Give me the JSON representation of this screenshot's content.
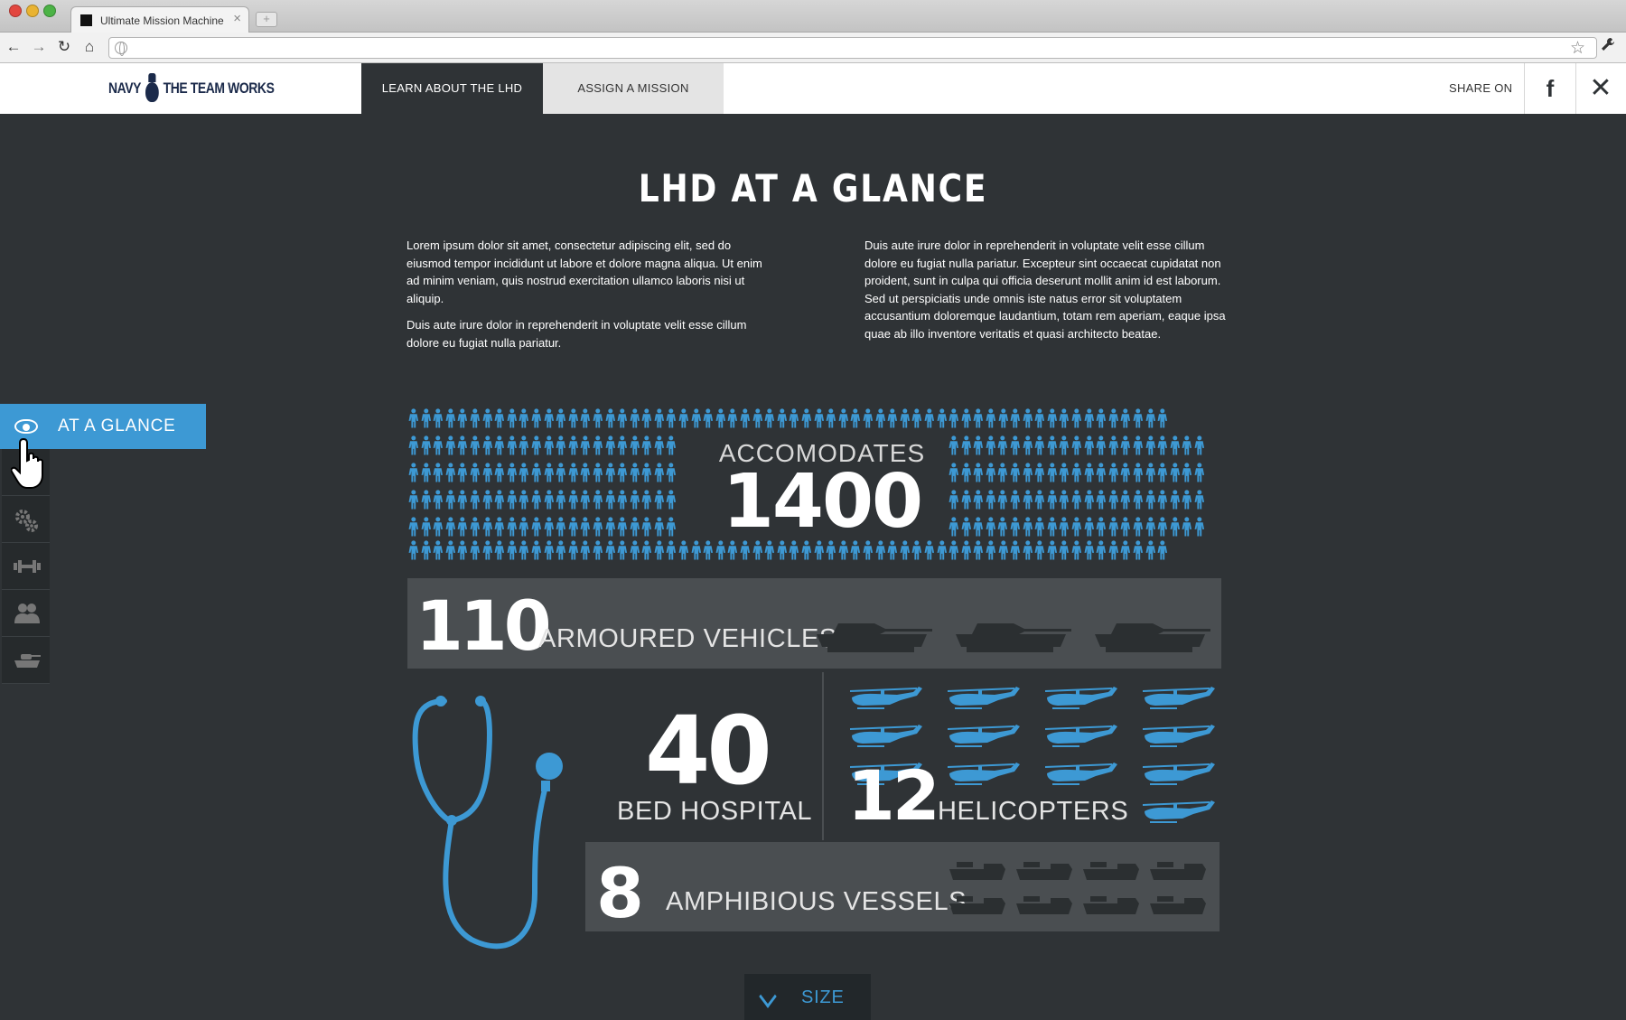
{
  "browser": {
    "tab_title": "Ultimate Mission Machine",
    "tab_close": "×",
    "new_tab": "+",
    "url": "",
    "back": "←",
    "forward": "→",
    "reload": "↻",
    "home": "⌂",
    "star": "☆",
    "wrench": "🔧"
  },
  "header": {
    "logo_left": "NAVY",
    "logo_right": "THE TEAM WORKS",
    "tabs": [
      {
        "label": "LEARN ABOUT THE LHD",
        "active": true
      },
      {
        "label": "ASSIGN A MISSION",
        "active": false
      }
    ],
    "share_label": "SHARE ON",
    "facebook": "f",
    "close": "✕"
  },
  "sidebar": {
    "active_label": "AT A GLANCE",
    "items": [
      "settings-gears-icon",
      "dumbbell-icon",
      "people-icon",
      "tank-icon"
    ]
  },
  "main": {
    "title": "LHD AT A GLANCE",
    "left_paragraphs": [
      "Lorem ipsum dolor sit amet, consectetur adipiscing elit, sed do eiusmod tempor incididunt ut labore et dolore magna aliqua. Ut enim ad minim veniam, quis nostrud exercitation ullamco laboris nisi ut aliquip.",
      "Duis aute irure dolor in reprehenderit in voluptate velit esse cillum dolore eu fugiat nulla pariatur."
    ],
    "right_paragraph": "Duis aute irure dolor in reprehenderit in voluptate velit esse cillum dolore eu fugiat nulla pariatur. Excepteur sint occaecat cupidatat non proident, sunt in culpa qui officia deserunt mollit anim id est laborum. Sed ut perspiciatis unde omnis iste natus error sit voluptatem accusantium doloremque laudantium, totam rem aperiam, eaque ipsa quae ab illo inventore veritatis et quasi architecto beatae."
  },
  "stats": {
    "accommodates_label": "ACCOMODATES",
    "accommodates_value": "1400",
    "vehicles_value": "110",
    "vehicles_label": "ARMOURED VEHICLES",
    "hospital_value": "40",
    "hospital_label": "BED HOSPITAL",
    "helicopters_value": "12",
    "helicopters_label": "HELICOPTERS",
    "vessels_value": "8",
    "vessels_label": "AMPHIBIOUS VESSELS"
  },
  "footer": {
    "size_label": "SIZE"
  },
  "colors": {
    "accent": "#3d99d4",
    "background": "#2f3336",
    "panel": "#4a4e51",
    "silhouette": "#2b2f31"
  }
}
